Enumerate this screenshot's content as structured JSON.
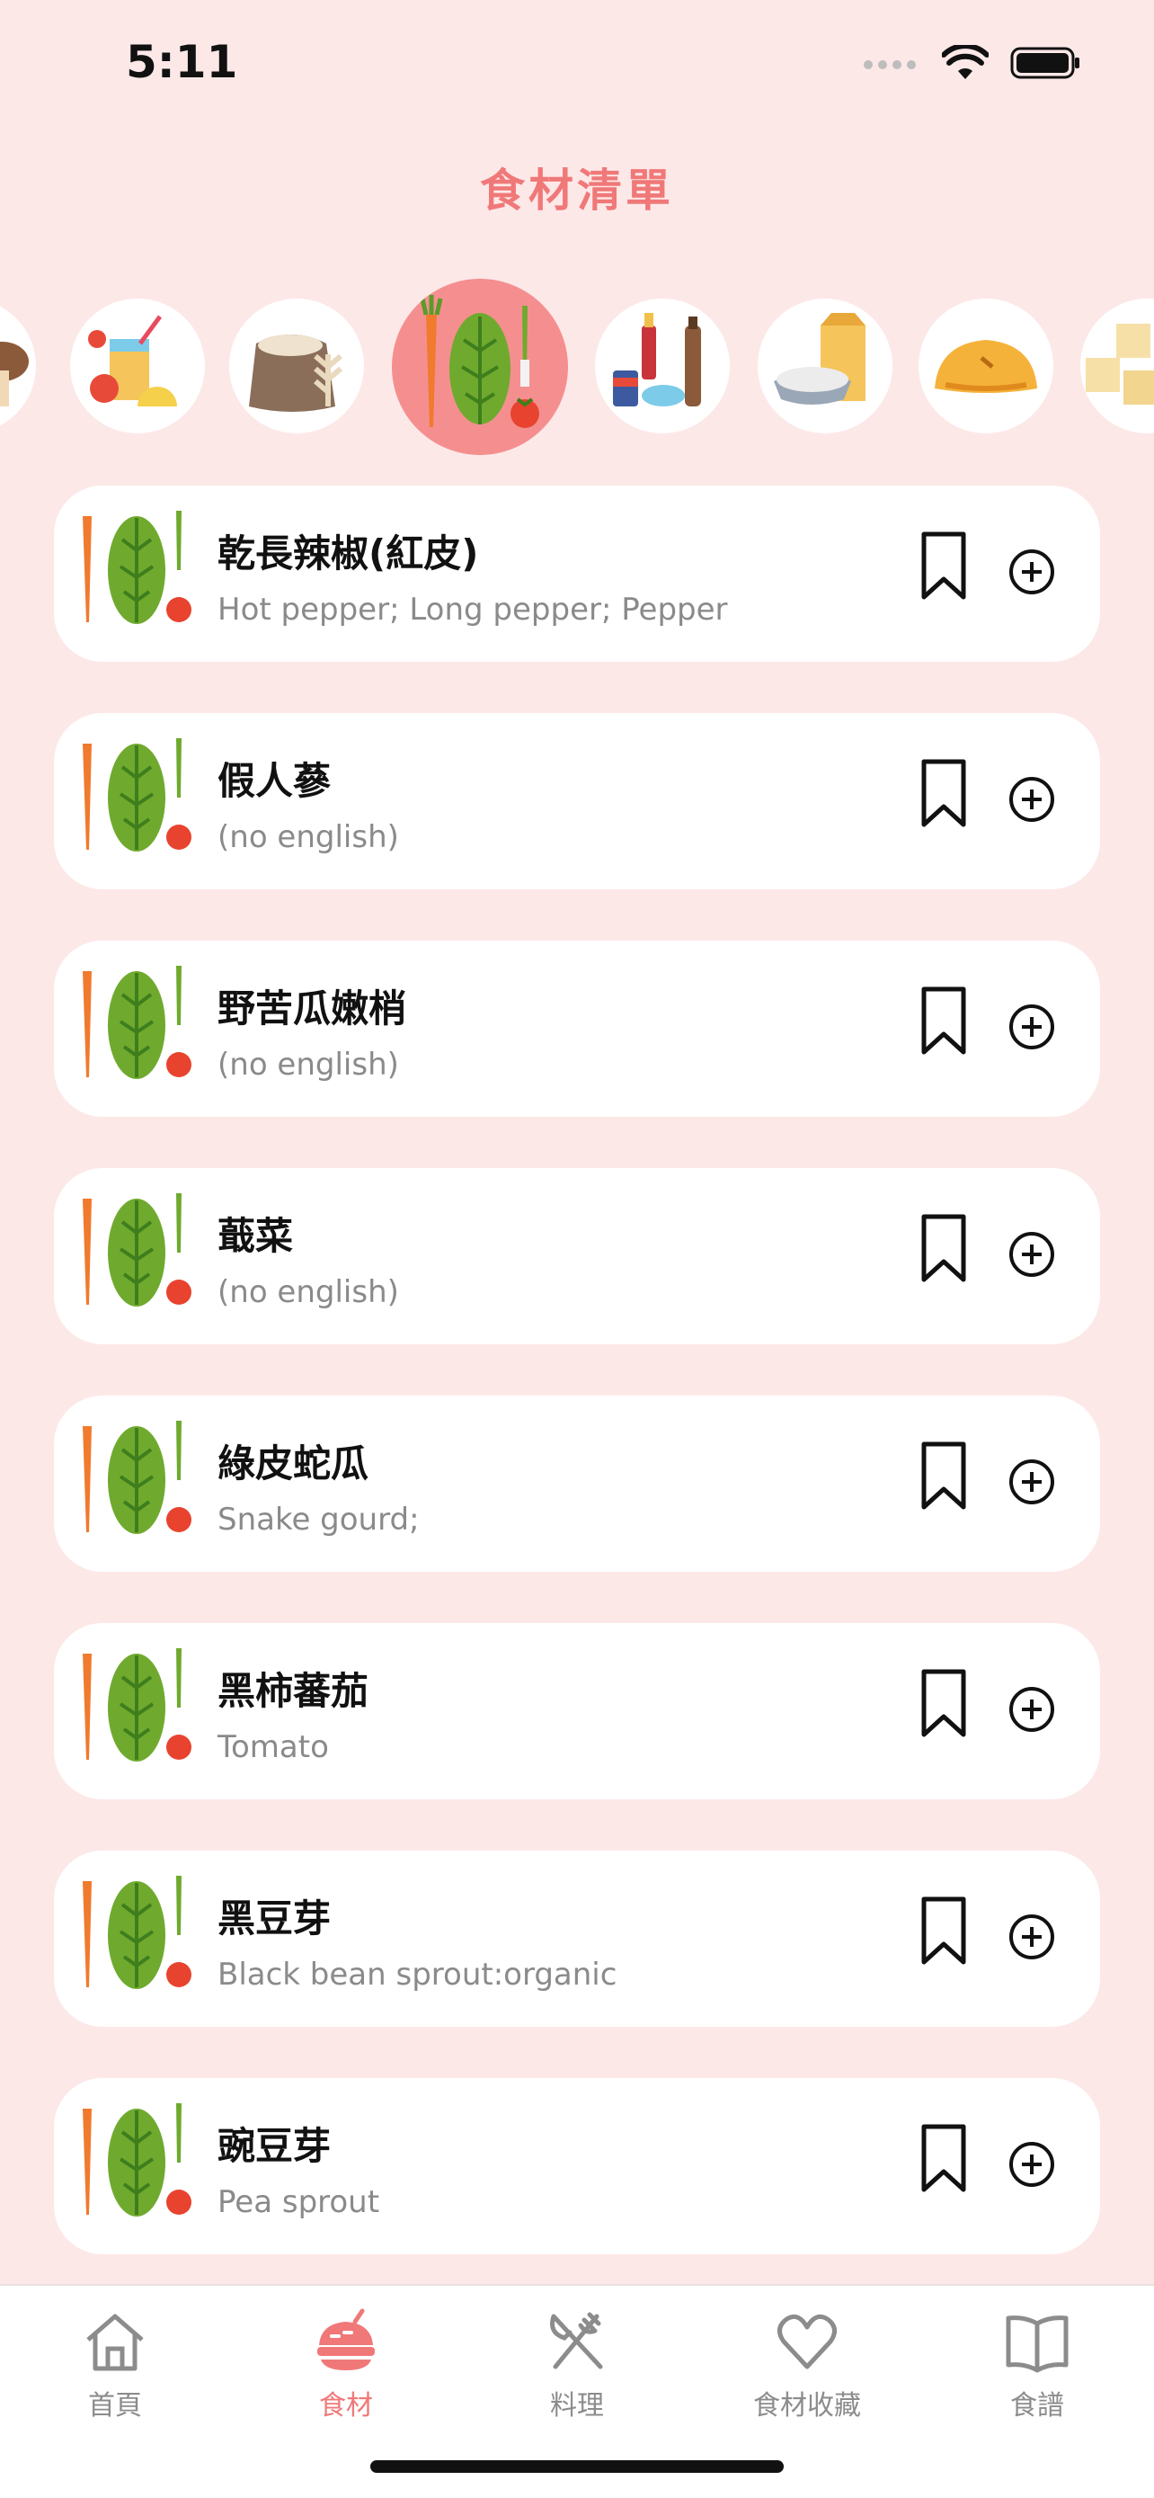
{
  "status_bar": {
    "time": "5:11"
  },
  "header": {
    "title": "食材清單"
  },
  "categories": [
    {
      "icon": "mushroom-icon"
    },
    {
      "icon": "fruit-juice-icon"
    },
    {
      "icon": "grain-sack-icon"
    },
    {
      "icon": "vegetables-icon",
      "active": true
    },
    {
      "icon": "condiments-icon"
    },
    {
      "icon": "rice-milk-icon"
    },
    {
      "icon": "dumpling-icon"
    },
    {
      "icon": "tofu-icon"
    }
  ],
  "ingredients": [
    {
      "name": "乾長辣椒(紅皮)",
      "english": "Hot pepper; Long pepper; Pepper"
    },
    {
      "name": "假人蔘",
      "english": "(no english)"
    },
    {
      "name": "野苦瓜嫩梢",
      "english": "(no english)"
    },
    {
      "name": "蕺菜",
      "english": "(no english)"
    },
    {
      "name": "綠皮蛇瓜",
      "english": "Snake gourd;"
    },
    {
      "name": "黑柿蕃茄",
      "english": "Tomato"
    },
    {
      "name": "黑豆芽",
      "english": "Black bean sprout:organic"
    },
    {
      "name": "豌豆芽",
      "english": "Pea sprout"
    }
  ],
  "tabs": [
    {
      "label": "首頁",
      "icon": "home-icon"
    },
    {
      "label": "食材",
      "icon": "ingredients-icon",
      "active": true
    },
    {
      "label": "料理",
      "icon": "utensils-icon"
    },
    {
      "label": "食材收藏",
      "icon": "heart-icon"
    },
    {
      "label": "食譜",
      "icon": "book-icon"
    }
  ],
  "colors": {
    "background": "#fde8e8",
    "accent": "#f07878",
    "active_category": "#f58f8f"
  }
}
